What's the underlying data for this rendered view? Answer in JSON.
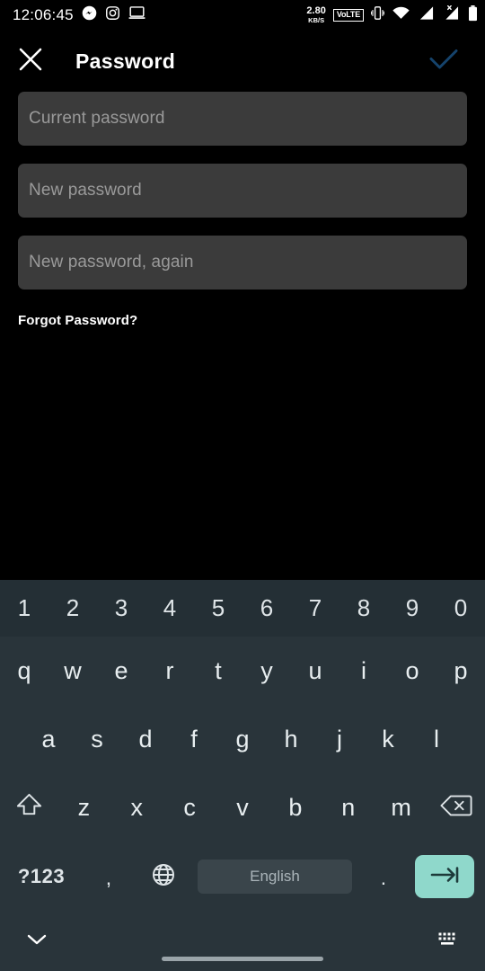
{
  "status_bar": {
    "clock": "12:06:45",
    "left_icons": [
      "messenger-icon",
      "instagram-icon",
      "laptop-cast-icon"
    ],
    "network_speed_value": "2.80",
    "network_speed_unit": "KB/S",
    "volte_label": "VoLTE",
    "right_icons": [
      "vibrate-icon",
      "wifi-icon",
      "signal-bar-icon",
      "signal-x-icon",
      "battery-icon"
    ]
  },
  "app_bar": {
    "title": "Password",
    "close_icon": "close-icon",
    "confirm_icon": "check-icon",
    "accent_check_color": "#0e3a5e"
  },
  "form": {
    "fields": [
      {
        "name": "current-password",
        "placeholder": "Current password",
        "value": ""
      },
      {
        "name": "new-password",
        "placeholder": "New password",
        "value": ""
      },
      {
        "name": "new-password-again",
        "placeholder": "New password, again",
        "value": ""
      }
    ],
    "forgot_link": "Forgot Password?"
  },
  "keyboard": {
    "background": "#29343a",
    "digit_row_background": "#242f35",
    "digits": [
      "1",
      "2",
      "3",
      "4",
      "5",
      "6",
      "7",
      "8",
      "9",
      "0"
    ],
    "row_top": [
      "q",
      "w",
      "e",
      "r",
      "t",
      "y",
      "u",
      "i",
      "o",
      "p"
    ],
    "row_home": [
      "a",
      "s",
      "d",
      "f",
      "g",
      "h",
      "j",
      "k",
      "l"
    ],
    "row_bottom": [
      "z",
      "x",
      "c",
      "v",
      "b",
      "n",
      "m"
    ],
    "shift_icon": "shift-icon",
    "backspace_icon": "backspace-icon",
    "symbols_key": "?123",
    "comma_key": ",",
    "period_key": ".",
    "globe_icon": "globe-icon",
    "space_label": "English",
    "enter_icon": "tab-enter-icon",
    "enter_key_color": "#8fd8cb"
  },
  "nav_footer": {
    "hide_keyboard_icon": "chevron-down-icon",
    "switch_keyboard_icon": "keyboard-icon",
    "home_indicator": "home-indicator"
  }
}
